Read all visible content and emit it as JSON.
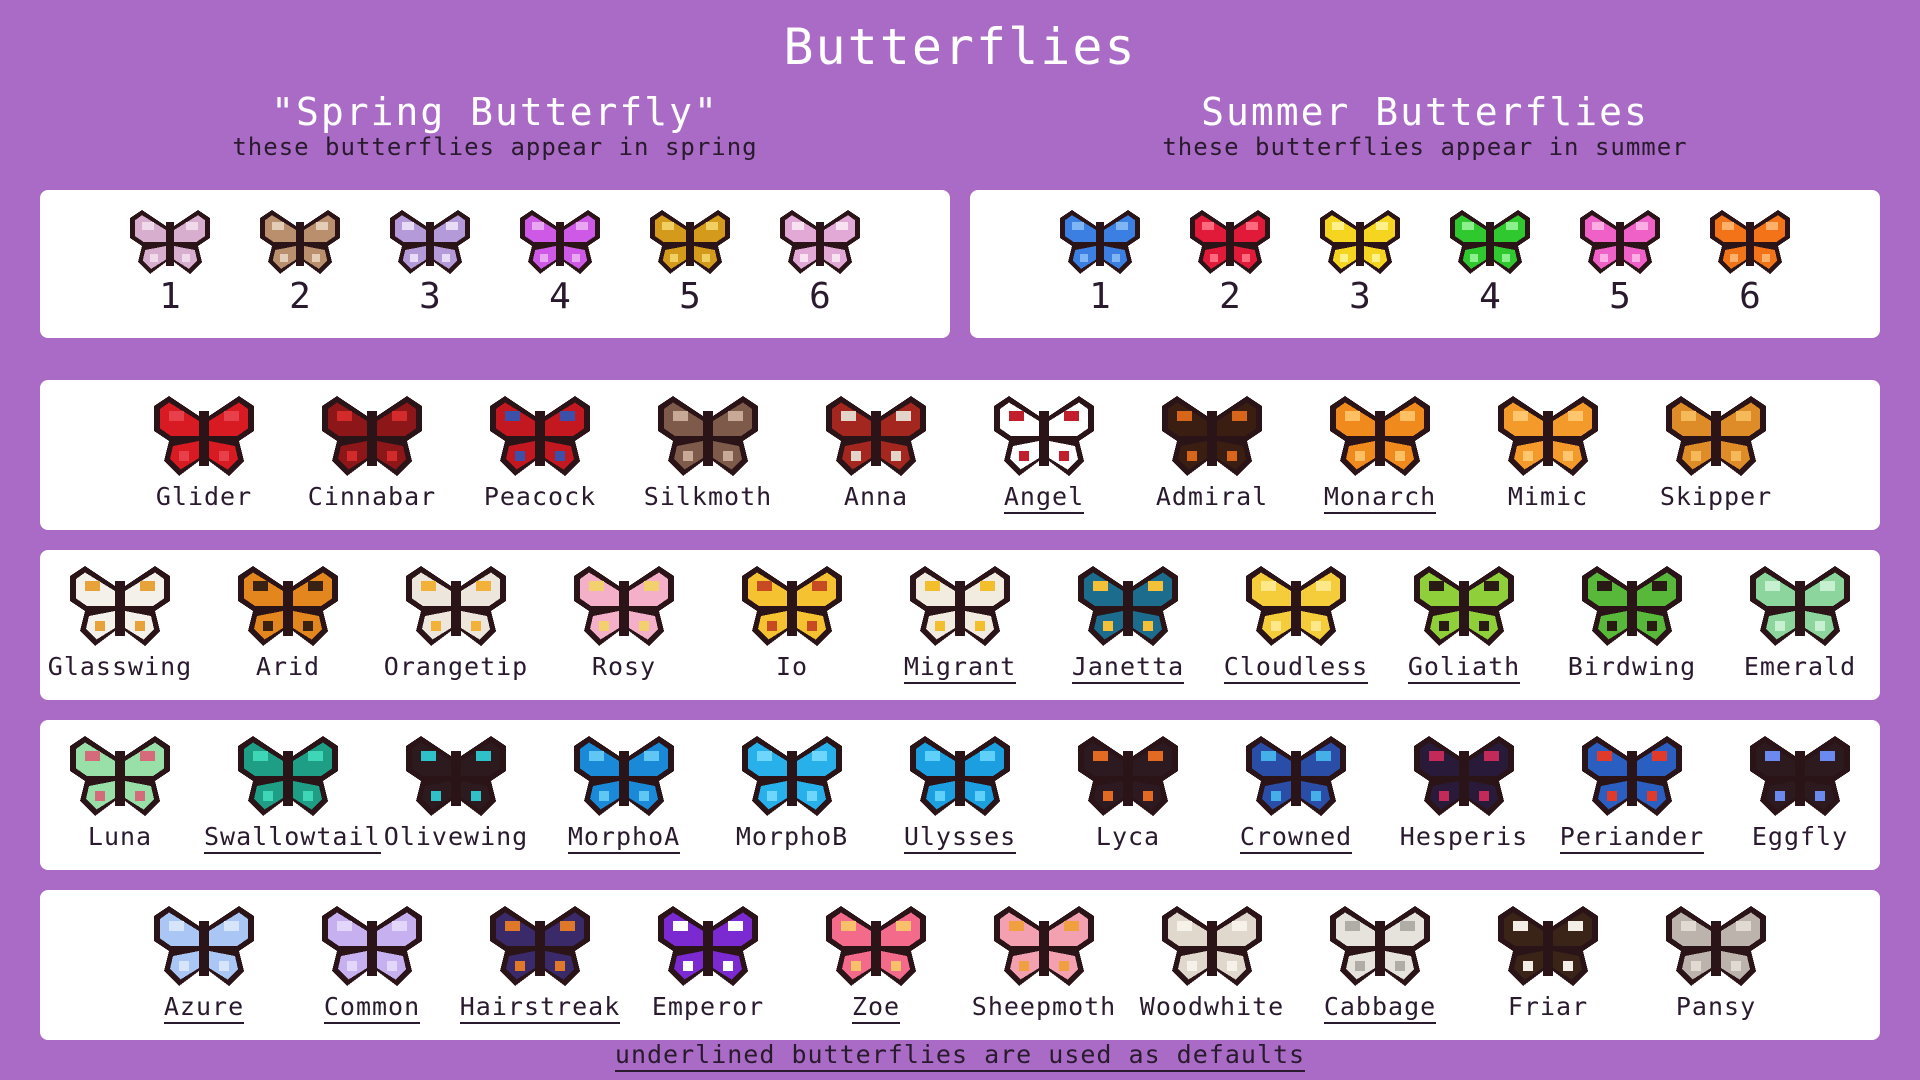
{
  "title": "Butterflies",
  "spring": {
    "heading": "\"Spring Butterfly\"",
    "subtitle": "these butterflies appear in spring",
    "items": [
      {
        "num": "1",
        "colors": {
          "a": "#d7aecd",
          "b": "#f0d9ea"
        }
      },
      {
        "num": "2",
        "colors": {
          "a": "#b98f6d",
          "b": "#e4cdb7"
        }
      },
      {
        "num": "3",
        "colors": {
          "a": "#b49ad8",
          "b": "#e7dbf5"
        }
      },
      {
        "num": "4",
        "colors": {
          "a": "#cd59e6",
          "b": "#e8a6f3"
        }
      },
      {
        "num": "5",
        "colors": {
          "a": "#d49a1c",
          "b": "#f0cf63"
        }
      },
      {
        "num": "6",
        "colors": {
          "a": "#e3a9d6",
          "b": "#f8e2f1"
        }
      }
    ]
  },
  "summer": {
    "heading": "Summer Butterflies",
    "subtitle": "these butterflies appear in summer",
    "items": [
      {
        "num": "1",
        "colors": {
          "a": "#3b7fe3",
          "b": "#7fb4f5"
        }
      },
      {
        "num": "2",
        "colors": {
          "a": "#e21a3a",
          "b": "#ff6a7e"
        }
      },
      {
        "num": "3",
        "colors": {
          "a": "#f5d51f",
          "b": "#fff08a"
        }
      },
      {
        "num": "4",
        "colors": {
          "a": "#2fc92f",
          "b": "#8cf08c"
        }
      },
      {
        "num": "5",
        "colors": {
          "a": "#f061c8",
          "b": "#ffaee5"
        }
      },
      {
        "num": "6",
        "colors": {
          "a": "#f37418",
          "b": "#ffb06a"
        }
      }
    ]
  },
  "rows": [
    [
      {
        "name": "Glider",
        "underlined": false,
        "colors": {
          "a": "#d81b22",
          "b": "#e8404a"
        }
      },
      {
        "name": "Cinnabar",
        "underlined": false,
        "colors": {
          "a": "#8c1618",
          "b": "#d32b2b"
        }
      },
      {
        "name": "Peacock",
        "underlined": false,
        "colors": {
          "a": "#c41820",
          "b": "#3b50a8"
        }
      },
      {
        "name": "Silkmoth",
        "underlined": false,
        "colors": {
          "a": "#7d5a4a",
          "b": "#c8a896"
        }
      },
      {
        "name": "Anna",
        "underlined": false,
        "colors": {
          "a": "#a3271e",
          "b": "#e2d4c8"
        }
      },
      {
        "name": "Angel",
        "underlined": true,
        "colors": {
          "a": "#ffffff",
          "b": "#c21f2c"
        }
      },
      {
        "name": "Admiral",
        "underlined": false,
        "colors": {
          "a": "#3a1e12",
          "b": "#d8661a"
        }
      },
      {
        "name": "Monarch",
        "underlined": true,
        "colors": {
          "a": "#f08a1c",
          "b": "#ffc064"
        }
      },
      {
        "name": "Mimic",
        "underlined": false,
        "colors": {
          "a": "#f39a2a",
          "b": "#ffc66e"
        }
      },
      {
        "name": "Skipper",
        "underlined": false,
        "colors": {
          "a": "#dd8c27",
          "b": "#f5b95a"
        }
      }
    ],
    [
      {
        "name": "Glasswing",
        "underlined": false,
        "colors": {
          "a": "#f4f0ea",
          "b": "#e8a23a"
        }
      },
      {
        "name": "Arid",
        "underlined": false,
        "colors": {
          "a": "#e3861d",
          "b": "#3a2212"
        }
      },
      {
        "name": "Orangetip",
        "underlined": false,
        "colors": {
          "a": "#ece6dc",
          "b": "#f2b23a"
        }
      },
      {
        "name": "Rosy",
        "underlined": false,
        "colors": {
          "a": "#f3b0c8",
          "b": "#f3d06e"
        }
      },
      {
        "name": "Io",
        "underlined": false,
        "colors": {
          "a": "#f5c232",
          "b": "#c64a22"
        }
      },
      {
        "name": "Migrant",
        "underlined": true,
        "colors": {
          "a": "#f2ebe0",
          "b": "#f3be2c"
        }
      },
      {
        "name": "Janetta",
        "underlined": true,
        "colors": {
          "a": "#1c6c8e",
          "b": "#f4c038"
        }
      },
      {
        "name": "Cloudless",
        "underlined": true,
        "colors": {
          "a": "#f5cd3a",
          "b": "#ffe88a"
        }
      },
      {
        "name": "Goliath",
        "underlined": true,
        "colors": {
          "a": "#8fd03a",
          "b": "#2a1a14"
        }
      },
      {
        "name": "Birdwing",
        "underlined": false,
        "colors": {
          "a": "#57b83a",
          "b": "#2a1a14"
        }
      },
      {
        "name": "Emerald",
        "underlined": false,
        "colors": {
          "a": "#8cd69e",
          "b": "#c6f0cf"
        }
      }
    ],
    [
      {
        "name": "Luna",
        "underlined": false,
        "colors": {
          "a": "#98e0a8",
          "b": "#d46a7a"
        }
      },
      {
        "name": "Swallowtail",
        "underlined": true,
        "colors": {
          "a": "#1f9e86",
          "b": "#3fd6b8"
        }
      },
      {
        "name": "Olivewing",
        "underlined": false,
        "colors": {
          "a": "#2c1a1e",
          "b": "#2fc0c8"
        }
      },
      {
        "name": "MorphoA",
        "underlined": true,
        "colors": {
          "a": "#1a8ad8",
          "b": "#60c6f4"
        }
      },
      {
        "name": "MorphoB",
        "underlined": false,
        "colors": {
          "a": "#28b0ea",
          "b": "#6ed6fa"
        }
      },
      {
        "name": "Ulysses",
        "underlined": true,
        "colors": {
          "a": "#1c9fe0",
          "b": "#5fd0f8"
        }
      },
      {
        "name": "Lyca",
        "underlined": false,
        "colors": {
          "a": "#2c1a20",
          "b": "#e36a22"
        }
      },
      {
        "name": "Crowned",
        "underlined": true,
        "colors": {
          "a": "#2a4ea8",
          "b": "#45b0e8"
        }
      },
      {
        "name": "Hesperis",
        "underlined": false,
        "colors": {
          "a": "#2a1a3a",
          "b": "#c22a5a"
        }
      },
      {
        "name": "Periander",
        "underlined": true,
        "colors": {
          "a": "#2a5ec0",
          "b": "#e03a2a"
        }
      },
      {
        "name": "Eggfly",
        "underlined": false,
        "colors": {
          "a": "#2c1a1e",
          "b": "#6a8af0"
        }
      }
    ],
    [
      {
        "name": "Azure",
        "underlined": true,
        "colors": {
          "a": "#a9c6f5",
          "b": "#d6e5fb"
        }
      },
      {
        "name": "Common",
        "underlined": true,
        "colors": {
          "a": "#c6b0f0",
          "b": "#e2d6fa"
        }
      },
      {
        "name": "Hairstreak",
        "underlined": true,
        "colors": {
          "a": "#3a2a6a",
          "b": "#e0782a"
        }
      },
      {
        "name": "Emperor",
        "underlined": false,
        "colors": {
          "a": "#7a2ad0",
          "b": "#ffffff"
        }
      },
      {
        "name": "Zoe",
        "underlined": true,
        "colors": {
          "a": "#f46a8a",
          "b": "#f8c06a"
        }
      },
      {
        "name": "Sheepmoth",
        "underlined": false,
        "colors": {
          "a": "#f3a0b0",
          "b": "#f0a040"
        }
      },
      {
        "name": "Woodwhite",
        "underlined": false,
        "colors": {
          "a": "#e0d8cc",
          "b": "#f6f2ea"
        }
      },
      {
        "name": "Cabbage",
        "underlined": true,
        "colors": {
          "a": "#e6e2dc",
          "b": "#b0aca6"
        }
      },
      {
        "name": "Friar",
        "underlined": false,
        "colors": {
          "a": "#3a2418",
          "b": "#f4efe6"
        }
      },
      {
        "name": "Pansy",
        "underlined": false,
        "colors": {
          "a": "#bcb4ac",
          "b": "#e0dad2"
        }
      }
    ]
  ],
  "footer": "underlined butterflies are used as defaults"
}
